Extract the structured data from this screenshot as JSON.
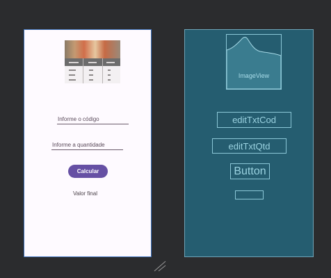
{
  "design": {
    "menu_image_title": "",
    "codigo_hint": "Informe o código",
    "quantidade_hint": "Informe a quantidade",
    "calcular_label": "Calcular",
    "valor_final_label": "Valor final"
  },
  "blueprint": {
    "imageview_label": "ImageView",
    "editcod_label": "editTxtCod",
    "editqtd_label": "editTxtQtd",
    "button_label": "Button",
    "textview_label": ""
  },
  "colors": {
    "canvas_bg": "#2b2c2e",
    "design_bg": "#fefaff",
    "blueprint_bg": "#255d70",
    "button_accent": "#6650a4",
    "blueprint_line": "#8cc8d8"
  },
  "icons": {
    "resize_handle": "resize-handle-icon",
    "image_placeholder": "image-placeholder-icon"
  }
}
